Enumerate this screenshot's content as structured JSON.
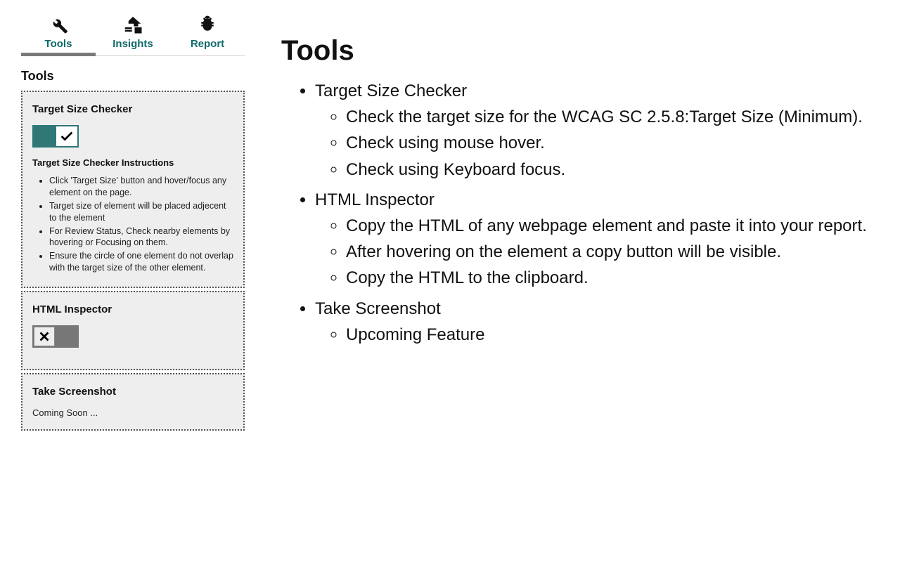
{
  "tabs": {
    "tools": "Tools",
    "insights": "Insights",
    "report": "Report"
  },
  "panel": {
    "title": "Tools",
    "card1": {
      "title": "Target Size Checker",
      "instructions_title": "Target Size Checker Instructions",
      "instructions": [
        "Click 'Target Size' button and hover/focus any element on the page.",
        "Target size of element will be placed adjecent to the element",
        "For Review Status, Check nearby elements by hovering or Focusing on them.",
        "Ensure the circle of one element do not overlap with the target size of the other element."
      ]
    },
    "card2": {
      "title": "HTML Inspector"
    },
    "card3": {
      "title": "Take Screenshot",
      "status": "Coming Soon ..."
    }
  },
  "doc": {
    "heading": "Tools",
    "items": [
      {
        "label": "Target Size Checker",
        "sub": [
          "Check the target size for the WCAG SC 2.5.8:Target Size (Minimum).",
          "Check using mouse hover.",
          "Check using Keyboard focus."
        ]
      },
      {
        "label": "HTML Inspector",
        "sub": [
          "Copy the HTML of any webpage element and paste it into your report.",
          "After hovering on the element a copy button will be visible.",
          "Copy the HTML to the clipboard."
        ]
      },
      {
        "label": "Take Screenshot",
        "sub": [
          "Upcoming Feature"
        ]
      }
    ]
  }
}
